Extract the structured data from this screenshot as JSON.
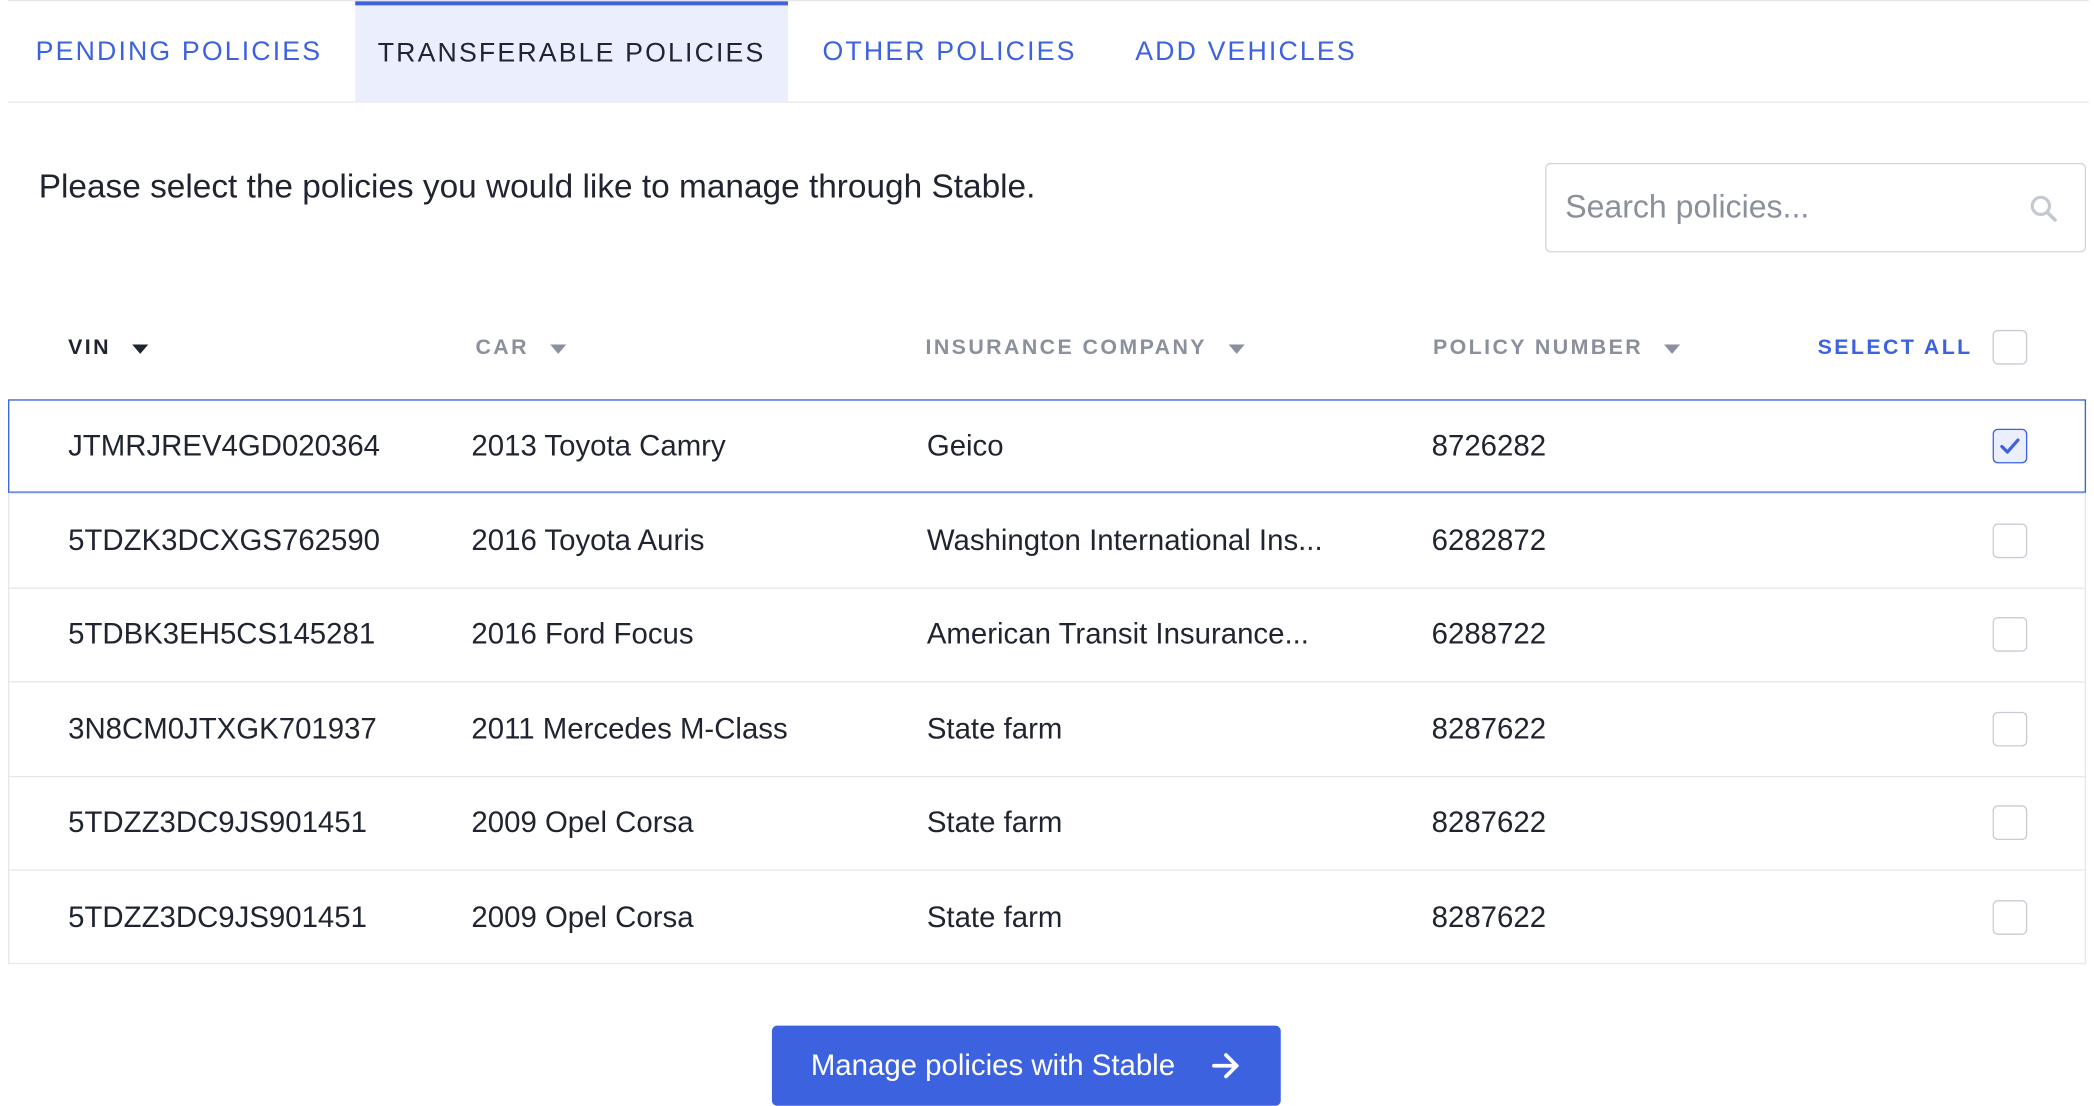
{
  "tabs": [
    {
      "label": "PENDING POLICIES",
      "active": false
    },
    {
      "label": "TRANSFERABLE POLICIES",
      "active": true
    },
    {
      "label": "OTHER POLICIES",
      "active": false
    },
    {
      "label": "ADD VEHICLES",
      "active": false
    }
  ],
  "prompt": "Please select the policies you would like to manage through Stable.",
  "search": {
    "placeholder": "Search policies...",
    "value": "",
    "icon": "search-icon"
  },
  "table": {
    "columns": [
      {
        "label": "VIN",
        "sortable": true,
        "active": true
      },
      {
        "label": "CAR",
        "sortable": true,
        "active": false
      },
      {
        "label": "INSURANCE COMPANY",
        "sortable": true,
        "active": false
      },
      {
        "label": "POLICY NUMBER",
        "sortable": true,
        "active": false
      }
    ],
    "select_all_label": "SELECT ALL",
    "select_all_checked": false,
    "rows": [
      {
        "vin": "JTMRJREV4GD020364",
        "car": "2013 Toyota Camry",
        "insurance": "Geico",
        "policy": "8726282",
        "checked": true
      },
      {
        "vin": "5TDZK3DCXGS762590",
        "car": "2016 Toyota Auris",
        "insurance": "Washington International Ins...",
        "policy": "6282872",
        "checked": false
      },
      {
        "vin": "5TDBK3EH5CS145281",
        "car": "2016 Ford Focus",
        "insurance": "American Transit Insurance...",
        "policy": "6288722",
        "checked": false
      },
      {
        "vin": "3N8CM0JTXGK701937",
        "car": "2011 Mercedes M-Class",
        "insurance": "State farm",
        "policy": "8287622",
        "checked": false
      },
      {
        "vin": "5TDZZ3DC9JS901451",
        "car": "2009 Opel Corsa",
        "insurance": "State farm",
        "policy": "8287622",
        "checked": false
      },
      {
        "vin": "5TDZZ3DC9JS901451",
        "car": "2009 Opel Corsa",
        "insurance": "State farm",
        "policy": "8287622",
        "checked": false
      }
    ]
  },
  "action_button": {
    "label": "Manage policies with Stable",
    "icon": "arrow-right-icon"
  },
  "colors": {
    "accent": "#3d62e0",
    "active_tab_bg": "#ebeffd",
    "text": "#1f2430",
    "muted": "#8a909c",
    "border": "#e6e8ee"
  }
}
